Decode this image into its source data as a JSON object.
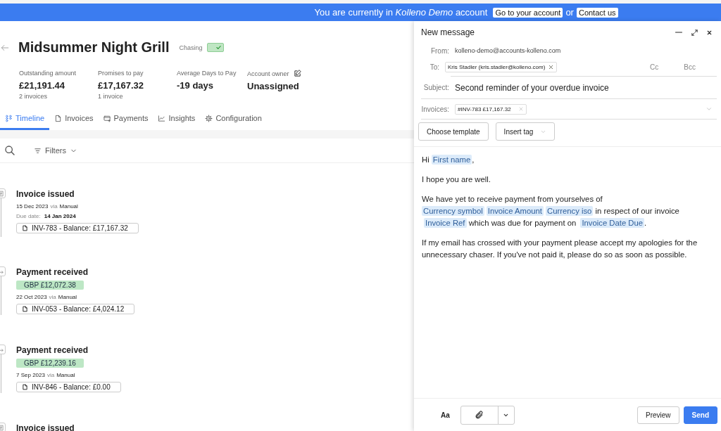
{
  "banner": {
    "message": "You are currently in *Kolleno Demo* account",
    "links": [
      "Go to your account",
      "Contact us"
    ],
    "separator": "or"
  },
  "account": {
    "title": "Midsummer Night Grill",
    "chasing": {
      "label": "Chasing",
      "on": true
    },
    "stats": [
      {
        "label": "Outstanding amount",
        "value": "£21,191.44",
        "note": "2 invoices"
      },
      {
        "label": "Promises to pay",
        "value": "£17,167.32",
        "note": "1 invoice"
      },
      {
        "label": "Average Days to Pay",
        "value": "-19 days"
      },
      {
        "label": "Account owner",
        "value": "Unassigned",
        "editable": true
      }
    ],
    "tabs": [
      {
        "label": "Timeline",
        "selected": true
      },
      {
        "label": "Invoices",
        "selected": false
      },
      {
        "label": "Payments",
        "selected": false
      },
      {
        "label": "Insights",
        "selected": false
      },
      {
        "label": "Configuration",
        "selected": false
      }
    ],
    "filters": "Filters",
    "timeline": [
      {
        "kind": "invoice",
        "title": "Invoice issued",
        "date": "15 Dec 2023",
        "via": "via",
        "source": "Manual",
        "due_label": "Due date:",
        "due": "14 Jan 2024",
        "invoice": "INV-783 - Balance: £17,167.32"
      },
      {
        "kind": "payment",
        "title": "Payment received",
        "amount": "GBP £12,072.38",
        "date": "22 Oct 2023",
        "via": "via",
        "source": "Manual",
        "invoice": "INV-053 - Balance: £4,024.12"
      },
      {
        "kind": "payment",
        "title": "Payment received",
        "amount": "GBP £12,239.16",
        "date": "7 Sep 2023",
        "via": "via",
        "source": "Manual",
        "invoice": "INV-846 - Balance: £0.00"
      },
      {
        "kind": "invoice",
        "title": "Invoice issued"
      }
    ]
  },
  "compose": {
    "title": "New message",
    "from_label": "From:",
    "from": "kolleno-demo@accounts-kolleno.com",
    "to_label": "To:",
    "recipients": [
      "Kris Stadler (kris.stadler@kolleno.com)"
    ],
    "cc": "Cc",
    "bcc": "Bcc",
    "subject_label": "Subject:",
    "subject": "Second reminder of your overdue invoice",
    "invoices_label": "Invoices:",
    "invoices": [
      "#INV-783 £17,167.32"
    ],
    "template_button": "Choose template",
    "tag_button": "Insert tag",
    "body": [
      [
        {
          "kind": "text",
          "text": "Hi "
        },
        {
          "kind": "tag",
          "text": "First name"
        },
        {
          "kind": "text",
          "text": ","
        }
      ],
      [
        {
          "kind": "text",
          "text": "I hope you are well."
        }
      ],
      [
        {
          "kind": "text",
          "text": "We have yet to receive payment from yourselves of "
        },
        {
          "kind": "tag",
          "text": "Currency symbol"
        },
        {
          "kind": "tag",
          "text": "Invoice Amount"
        },
        {
          "kind": "tag",
          "text": "Currency iso"
        },
        {
          "kind": "text",
          "text": " in respect of our invoice "
        },
        {
          "kind": "tag",
          "text": "Invoice Ref"
        },
        {
          "kind": "text",
          "text": " which was due for payment on "
        },
        {
          "kind": "tag",
          "text": "Invoice Date Due"
        },
        {
          "kind": "text",
          "text": "."
        }
      ],
      [
        {
          "kind": "text",
          "text": "If my email has crossed with your payment please accept my apologies for the unnecessary chaser. If you've not paid it, please do so as soon as possible."
        }
      ]
    ],
    "format_button": "Aa",
    "preview_button": "Preview",
    "send_button": "Send"
  }
}
